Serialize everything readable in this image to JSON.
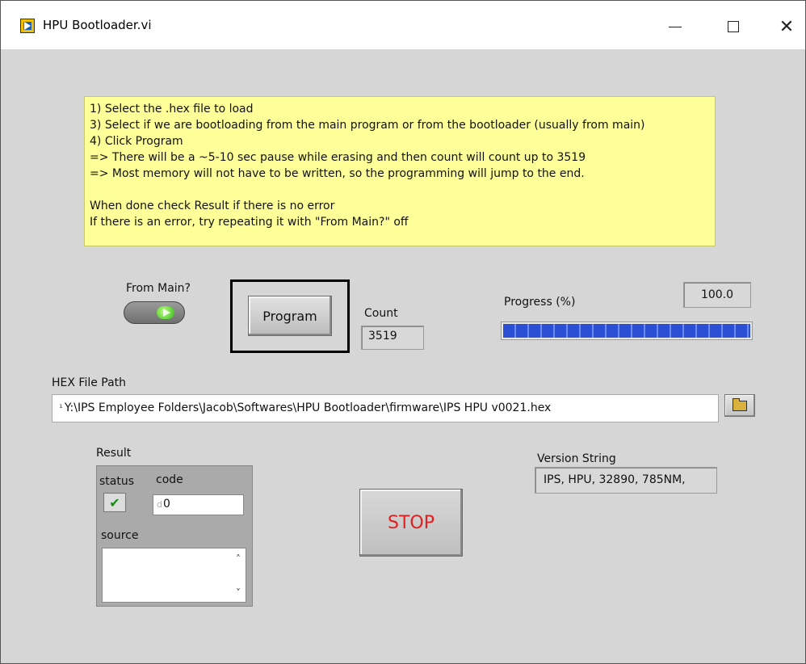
{
  "window": {
    "title": "HPU Bootloader.vi",
    "controls": [
      "minimize",
      "maximize",
      "close"
    ]
  },
  "instructions": {
    "lines": [
      "1) Select the .hex file to load",
      "3) Select if we are bootloading from the main program or from the bootloader (usually from main)",
      "4) Click Program",
      "=> There will be a ~5-10 sec pause while erasing and then count will count up to 3519",
      "=> Most memory will not have to be written, so the  programming will jump to the end.",
      "",
      "When done check Result if there is no error",
      "If there is an error, try repeating it with \"From Main?\" off"
    ]
  },
  "from_main": {
    "label": "From Main?",
    "state": "on"
  },
  "program_button": {
    "label": "Program"
  },
  "count": {
    "label": "Count",
    "value": "3519"
  },
  "progress": {
    "label": "Progress (%)",
    "value": "100.0",
    "fraction": 1.0
  },
  "hex_path": {
    "label": "HEX File Path",
    "value": "Y:\\IPS Employee Folders\\Jacob\\Softwares\\HPU Bootloader\\firmware\\IPS HPU v0021.hex"
  },
  "result": {
    "label": "Result",
    "status_label": "status",
    "code_label": "code",
    "code_radix": "d",
    "code_value": "0",
    "source_label": "source",
    "status_icon": "checkmark-icon"
  },
  "stop_button": {
    "label": "STOP"
  },
  "version": {
    "label": "Version String",
    "value": "IPS, HPU, 32890, 785NM,"
  },
  "colors": {
    "panel_bg": "#d6d6d6",
    "instructions_bg": "#ffff99",
    "stop_text": "#e02020",
    "progress_fill": "#2c4fd6",
    "led_on": "#34b81c"
  }
}
